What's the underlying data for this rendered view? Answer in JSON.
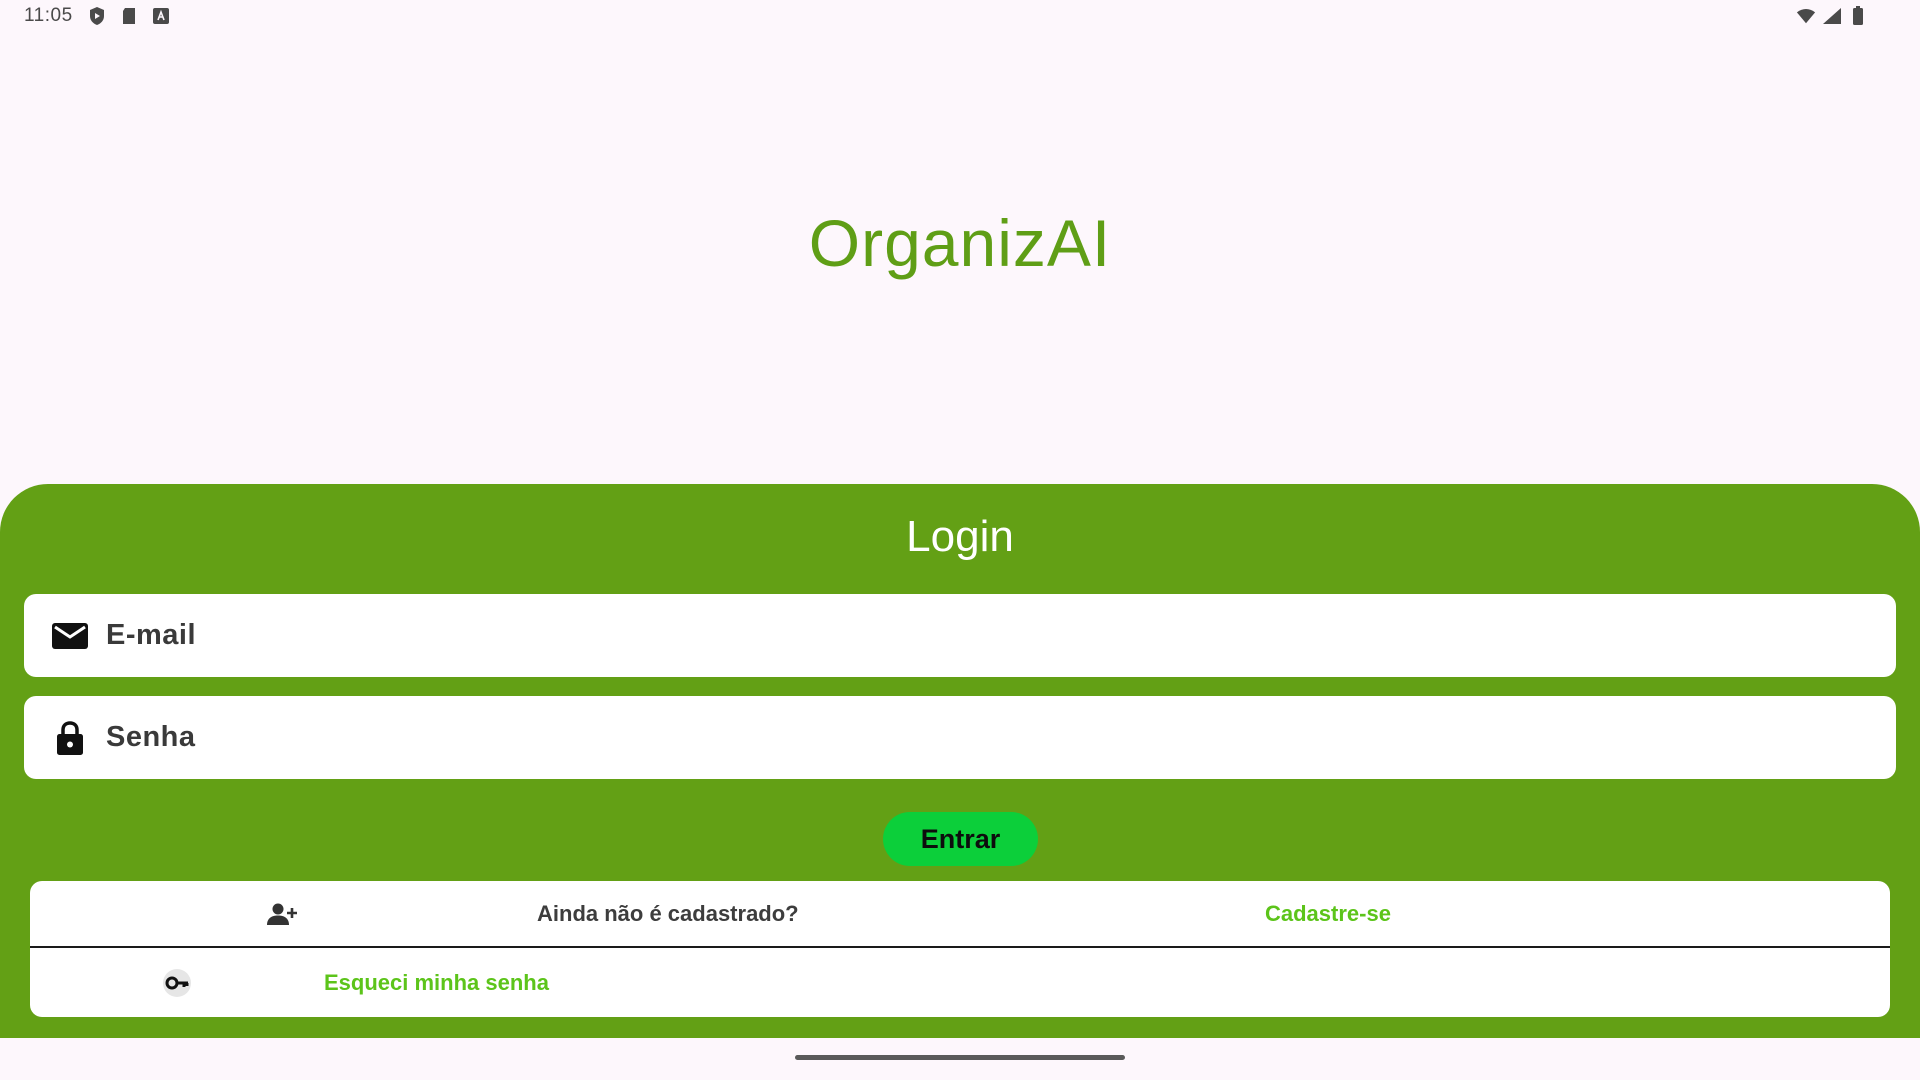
{
  "status_bar": {
    "time": "11:05",
    "left_icons": [
      "shield-play-icon",
      "sd-card-icon",
      "keyboard-a-icon"
    ],
    "right_icons": [
      "wifi-icon",
      "cell-signal-icon",
      "battery-icon"
    ]
  },
  "app": {
    "title": "OrganizAI"
  },
  "login": {
    "heading": "Login",
    "email": {
      "placeholder": "E-mail",
      "icon": "envelope-icon"
    },
    "password": {
      "placeholder": "Senha",
      "icon": "lock-icon"
    },
    "enter_label": "Entrar"
  },
  "links": {
    "signup_question": "Ainda não é cadastrado?",
    "signup_link": "Cadastre-se",
    "signup_icon": "person-add-icon",
    "forgot_link": "Esqueci minha senha",
    "forgot_icon": "key-icon"
  },
  "colors": {
    "background": "#fdf7fc",
    "brand_green": "#63a015",
    "title_green": "#5f9e16",
    "button_green": "#0ccf3a",
    "link_green": "#5cc41a"
  }
}
